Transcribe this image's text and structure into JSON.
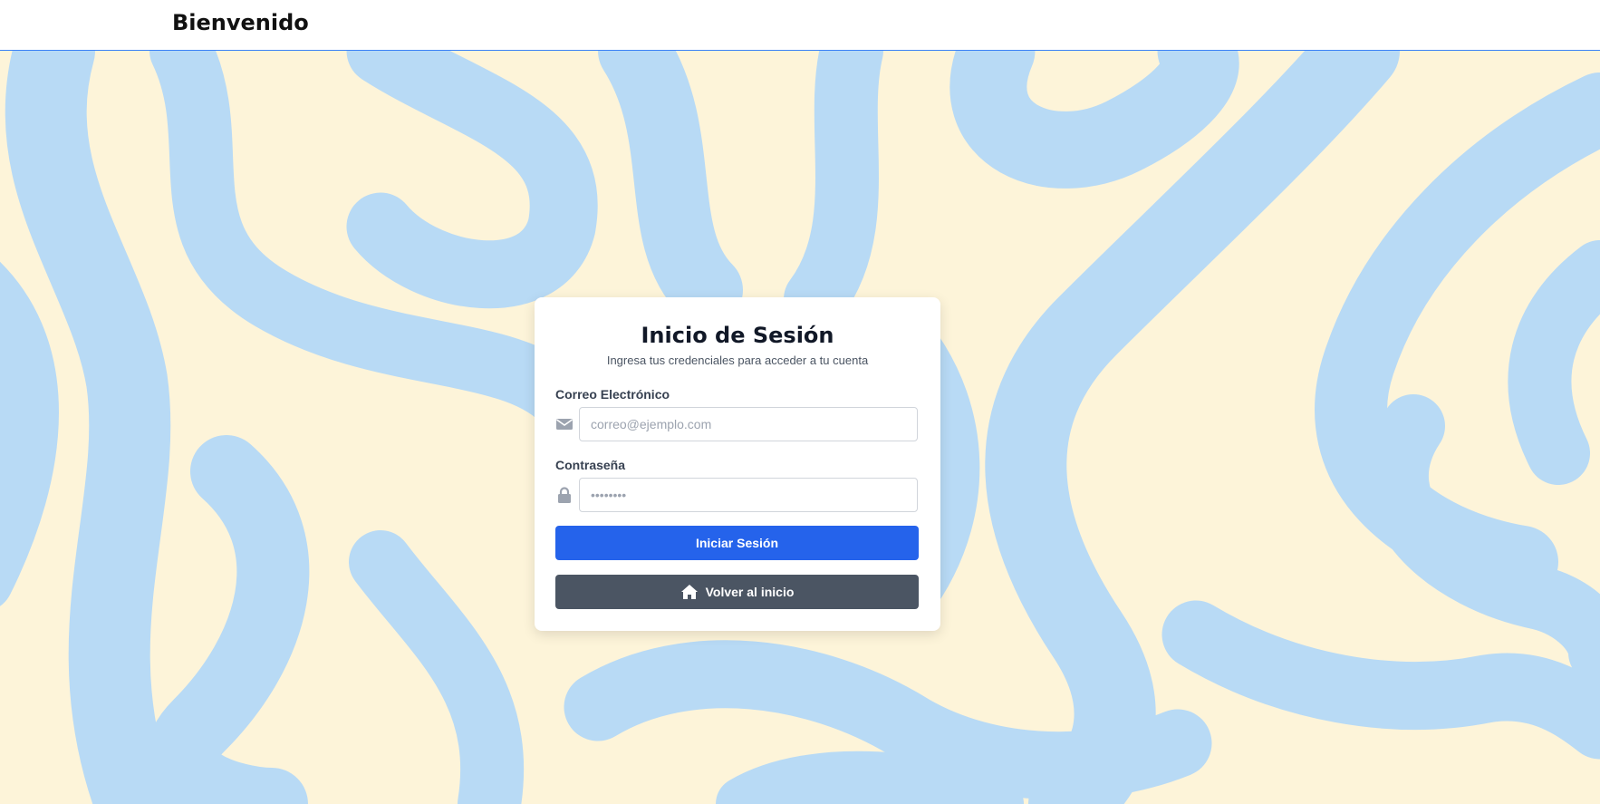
{
  "header": {
    "brand": "Bienvenido"
  },
  "login": {
    "title": "Inicio de Sesión",
    "subtitle": "Ingresa tus credenciales para acceder a tu cuenta",
    "email": {
      "label": "Correo Electrónico",
      "placeholder": "correo@ejemplo.com",
      "icon": "envelope-icon"
    },
    "password": {
      "label": "Contraseña",
      "placeholder": "••••••••",
      "icon": "lock-icon"
    },
    "submit_label": "Iniciar Sesión",
    "home_label": "Volver al inicio",
    "home_icon": "home-icon"
  },
  "colors": {
    "background_cream": "#fdf4d9",
    "background_blue": "#b8daf5",
    "primary_button": "#2563eb",
    "secondary_button": "#4b5563",
    "header_border": "#3b82f6"
  }
}
